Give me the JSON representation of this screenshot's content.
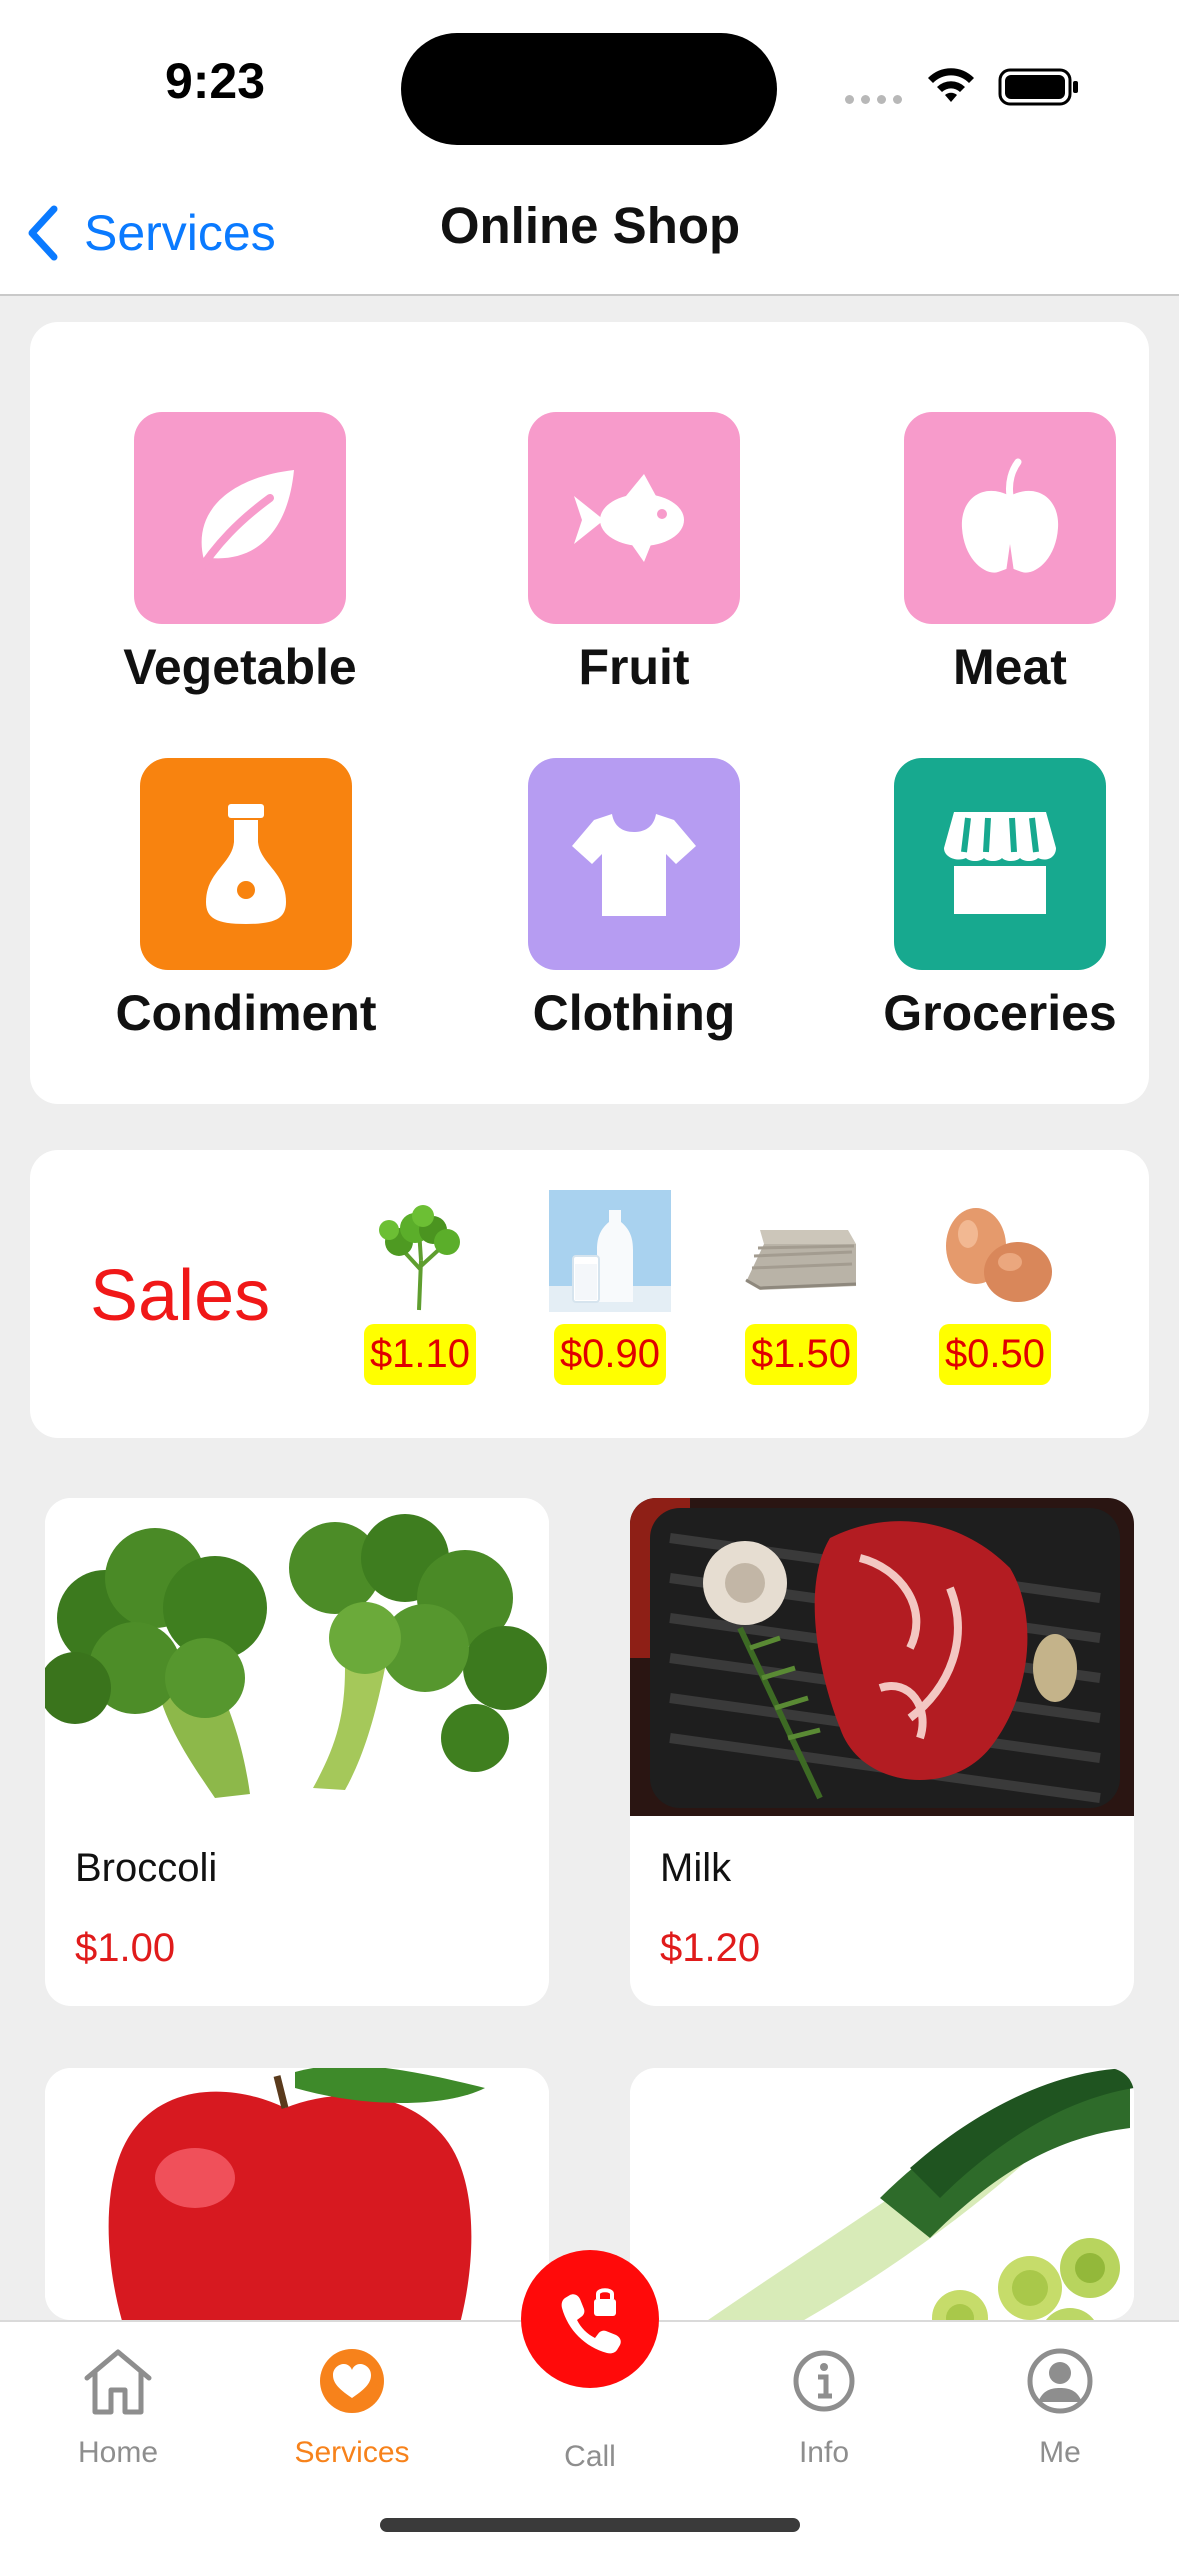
{
  "status_bar": {
    "time": "9:23"
  },
  "nav": {
    "back_label": "Services",
    "title": "Online Shop"
  },
  "categories": [
    {
      "label": "Vegetable",
      "icon": "leaf-icon",
      "color": "#F79BCB"
    },
    {
      "label": "Fruit",
      "icon": "fish-icon",
      "color": "#F79BCB"
    },
    {
      "label": "Meat",
      "icon": "apple-icon",
      "color": "#F79BCB"
    },
    {
      "label": "Condiment",
      "icon": "soy-sauce-bottle-icon",
      "color": "#F8830F"
    },
    {
      "label": "Clothing",
      "icon": "t-shirt-icon",
      "color": "#B69CF2"
    },
    {
      "label": "Groceries",
      "icon": "storefront-icon",
      "color": "#17A98F"
    }
  ],
  "sales": {
    "title": "Sales",
    "items": [
      {
        "image": "parsley",
        "price": "$1.10"
      },
      {
        "image": "milk",
        "price": "$0.90"
      },
      {
        "image": "folded-towels",
        "price": "$1.50"
      },
      {
        "image": "eggs",
        "price": "$0.50"
      }
    ]
  },
  "products": [
    {
      "name": "Broccoli",
      "price": "$1.00",
      "image": "broccoli"
    },
    {
      "name": "Milk",
      "price": "$1.20",
      "image": "steak-on-grill-pan"
    },
    {
      "name": "",
      "price": "",
      "image": "red-apple"
    },
    {
      "name": "",
      "price": "",
      "image": "leek"
    }
  ],
  "tabs": [
    {
      "label": "Home",
      "icon": "house-icon"
    },
    {
      "label": "Services",
      "icon": "heart-circle-icon",
      "active": true
    },
    {
      "label": "Call",
      "icon": "phone-lock-icon"
    },
    {
      "label": "Info",
      "icon": "info-circle-icon"
    },
    {
      "label": "Me",
      "icon": "person-circle-icon"
    }
  ],
  "colors": {
    "accent_blue": "#0A7AFF",
    "sale_red": "#F01818",
    "price_red": "#E01B1B",
    "tab_active": "#F7821B",
    "call_button": "#FF0A0A",
    "highlight_yellow": "#FFFF00"
  }
}
